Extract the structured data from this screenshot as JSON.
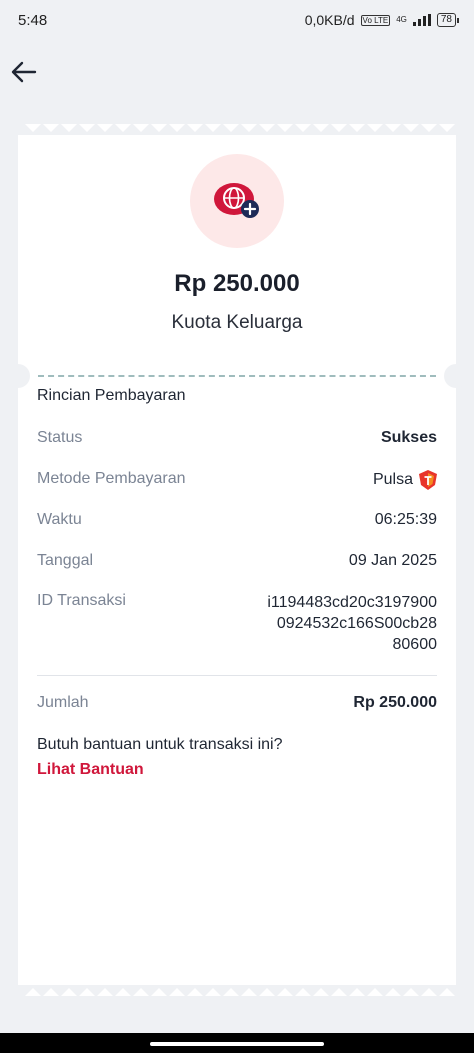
{
  "statusbar": {
    "time": "5:48",
    "network_speed": "0,0KB/d",
    "volte": "Vo LTE",
    "net_type": "4G",
    "battery": "78"
  },
  "header": {
    "back_icon": "arrow-left-icon"
  },
  "receipt": {
    "amount": "Rp 250.000",
    "product": "Kuota Keluarga",
    "product_icon": "globe-plus-icon",
    "section_title": "Rincian Pembayaran",
    "rows": {
      "status": {
        "label": "Status",
        "value": "Sukses"
      },
      "method": {
        "label": "Metode Pembayaran",
        "value": "Pulsa"
      },
      "time": {
        "label": "Waktu",
        "value": "06:25:39"
      },
      "date": {
        "label": "Tanggal",
        "value": "09 Jan 2025"
      },
      "txid": {
        "label": "ID Transaksi",
        "line1": "i1194483cd20c3197900",
        "line2": "0924532c166S00cb28",
        "line3": "80600"
      }
    },
    "total": {
      "label": "Jumlah",
      "value": "Rp 250.000"
    },
    "help": {
      "question": "Butuh bantuan untuk transaksi ini?",
      "link": "Lihat Bantuan"
    }
  },
  "colors": {
    "success": "#1e8a5a",
    "accent": "#d0173b",
    "icon_bg": "#fde8e8"
  }
}
